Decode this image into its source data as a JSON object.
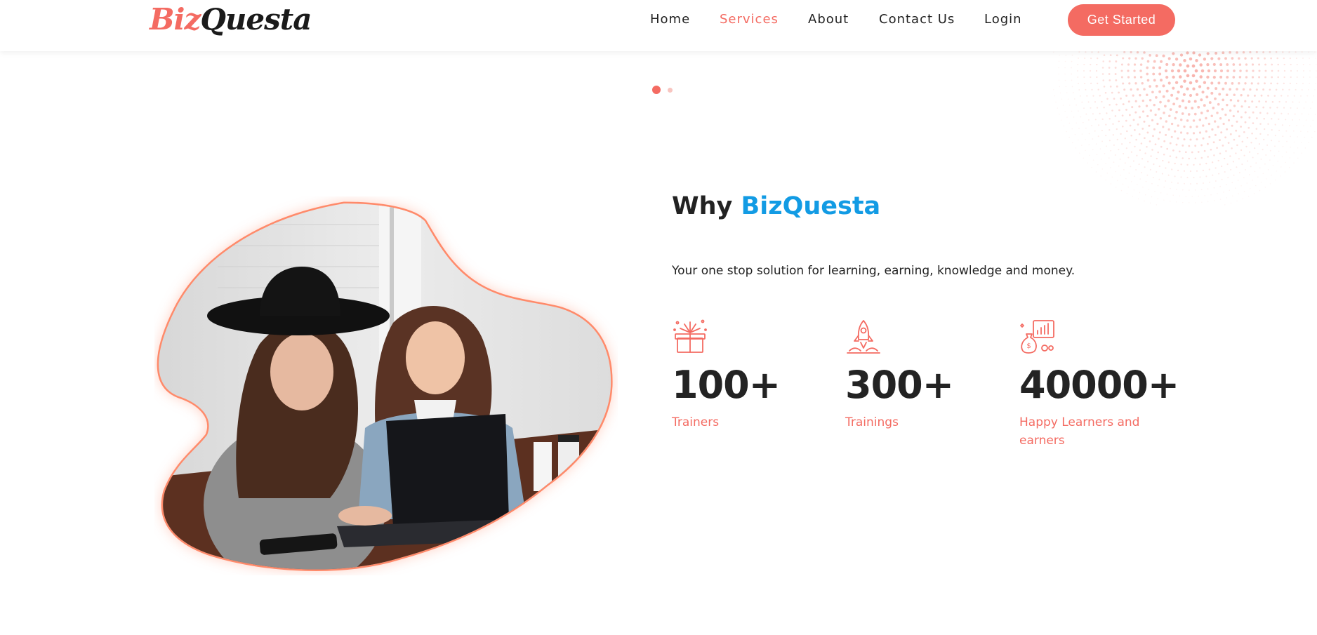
{
  "header": {
    "logo": {
      "part1": "Biz",
      "part2": "Questa"
    },
    "nav": [
      {
        "label": "Home",
        "active": false
      },
      {
        "label": "Services",
        "active": true
      },
      {
        "label": "About",
        "active": false
      },
      {
        "label": "Contact Us",
        "active": false
      },
      {
        "label": "Login",
        "active": false
      }
    ],
    "cta_label": "Get Started"
  },
  "carousel": {
    "slides": 2,
    "active_index": 0
  },
  "hero": {
    "image_alt": "two-women-using-laptop-photo",
    "title_prefix": "Why",
    "title_brand": "BizQuesta",
    "tagline": "Your one stop solution for learning, earning, knowledge and money."
  },
  "stats": [
    {
      "icon": "gift-box-icon",
      "value": "100+",
      "label": "Trainers"
    },
    {
      "icon": "rocket-icon",
      "value": "300+",
      "label": "Trainings"
    },
    {
      "icon": "money-bag-chart-icon",
      "value": "40000+",
      "label": "Happy Learners and earners"
    }
  ],
  "colors": {
    "accent": "#f46b62",
    "brand_blue": "#129be4",
    "text_dark": "#222222"
  }
}
